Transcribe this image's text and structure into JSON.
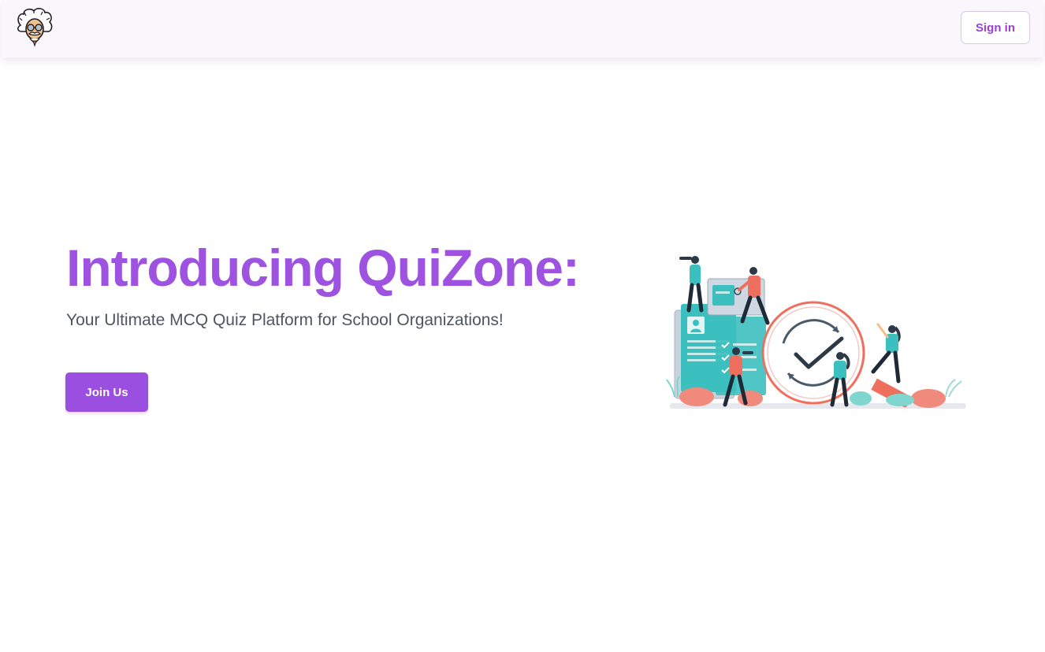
{
  "brand": {
    "logo_icon": "einstein-face-logo-icon"
  },
  "navbar": {
    "signin_label": "Sign in"
  },
  "hero": {
    "title": "Introducing QuiZone:",
    "subtitle": "Your Ultimate MCQ Quiz Platform for School Organizations!",
    "join_label": "Join Us",
    "illustration_icon": "quiz-checkmark-illustration"
  },
  "colors": {
    "accent": "#9b4fe0",
    "title": "#9d52e0",
    "subtitle": "#4e5561",
    "navbar_bg": "#f9f7fb",
    "teal": "#3cbfbf",
    "coral": "#ef6f5f"
  }
}
